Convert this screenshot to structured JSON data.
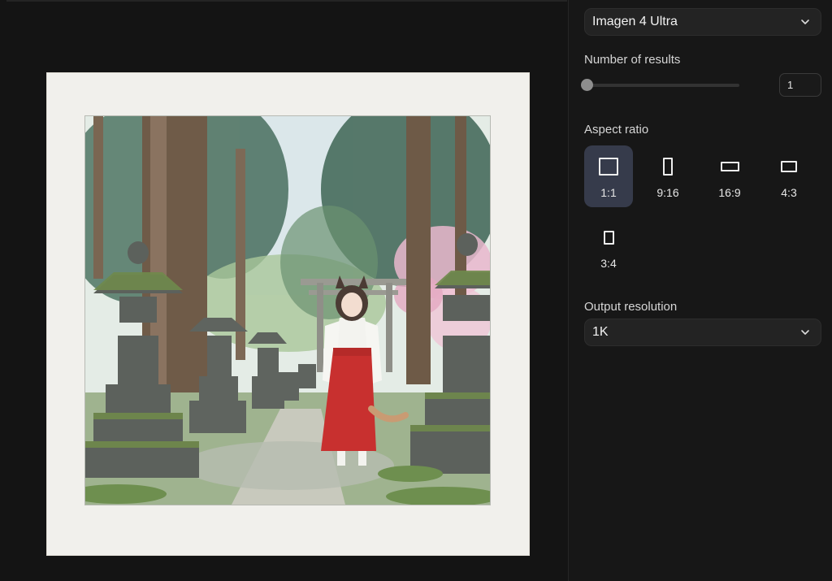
{
  "model_select": {
    "value": "Imagen 4 Ultra",
    "icon": "chevron-down-icon"
  },
  "results": {
    "label": "Number of results",
    "value": "1",
    "slider_fraction": 0.0
  },
  "aspect": {
    "label": "Aspect ratio",
    "options": [
      {
        "label": "1:1",
        "selected": true
      },
      {
        "label": "9:16",
        "selected": false
      },
      {
        "label": "16:9",
        "selected": false
      },
      {
        "label": "4:3",
        "selected": false
      },
      {
        "label": "3:4",
        "selected": false
      }
    ]
  },
  "resolution": {
    "label": "Output resolution",
    "value": "1K",
    "icon": "chevron-down-icon"
  },
  "colors": {
    "panel_bg": "#171717",
    "selected_ratio_bg": "#363b4b",
    "paper": "#f1f0ec"
  }
}
